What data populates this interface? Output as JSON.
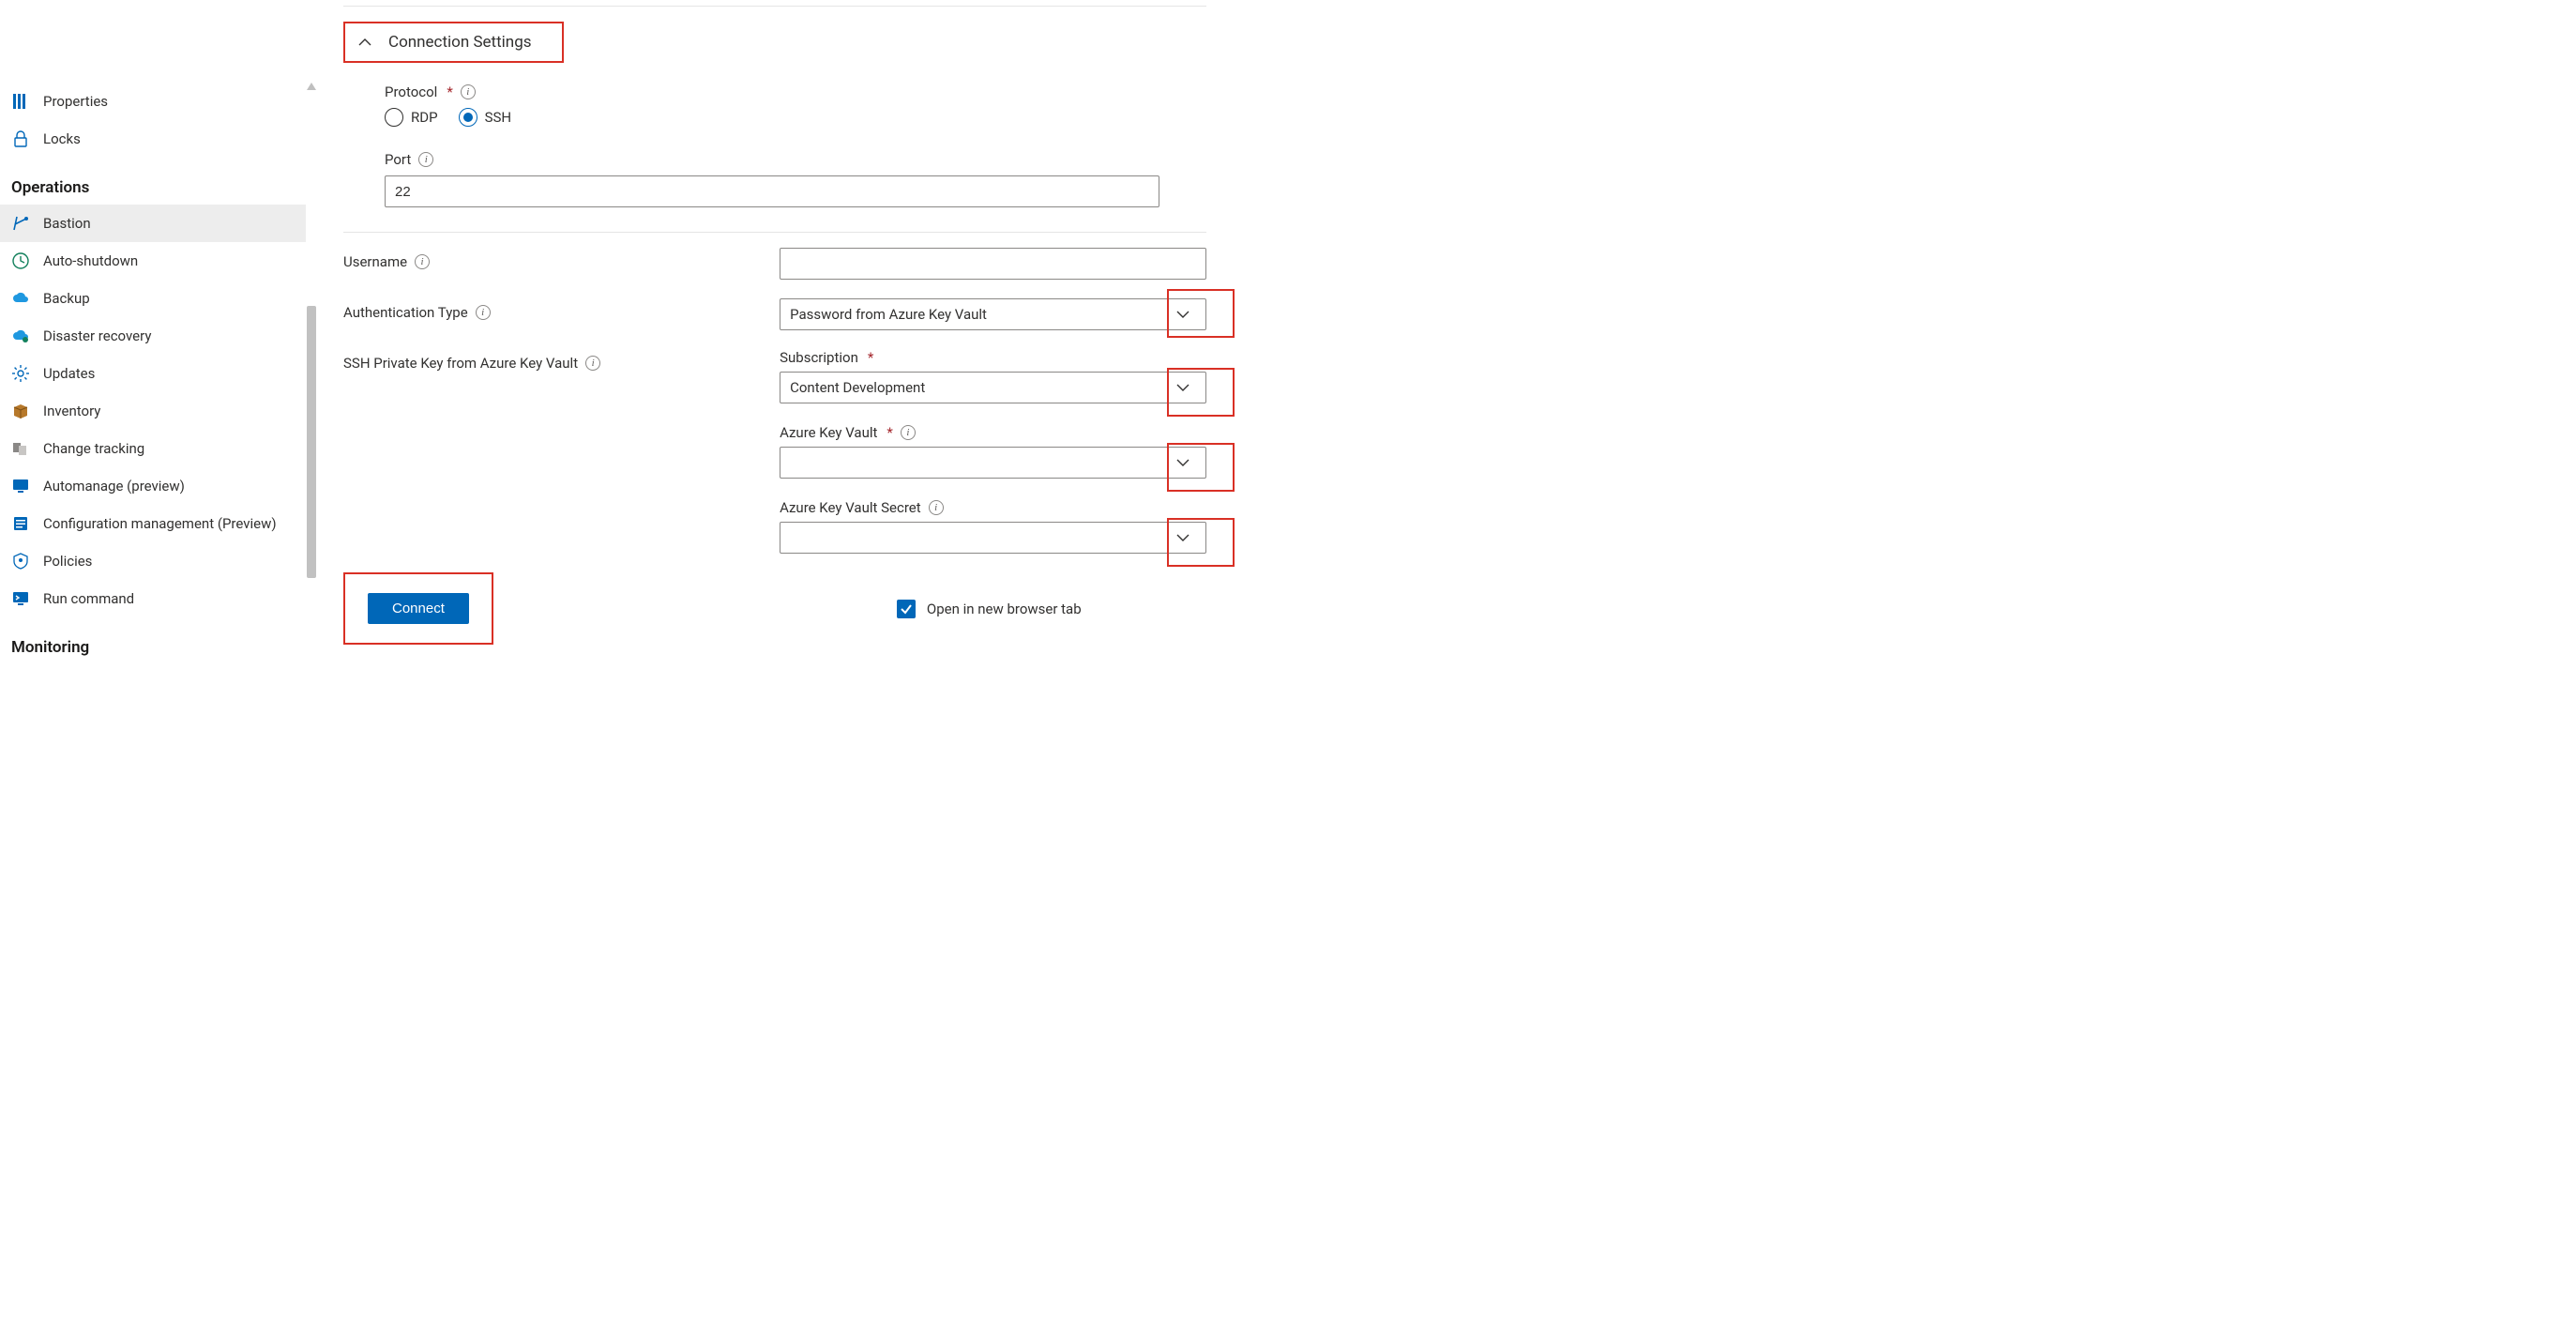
{
  "sidebar": {
    "items": [
      {
        "label": "Properties",
        "icon": "properties-icon"
      },
      {
        "label": "Locks",
        "icon": "lock-icon"
      }
    ],
    "heading1": "Operations",
    "operations": [
      {
        "label": "Bastion",
        "icon": "bastion-icon",
        "selected": true
      },
      {
        "label": "Auto-shutdown",
        "icon": "clock-icon"
      },
      {
        "label": "Backup",
        "icon": "cloud-backup-icon"
      },
      {
        "label": "Disaster recovery",
        "icon": "cloud-dr-icon"
      },
      {
        "label": "Updates",
        "icon": "gear-icon"
      },
      {
        "label": "Inventory",
        "icon": "box-icon"
      },
      {
        "label": "Change tracking",
        "icon": "change-tracking-icon"
      },
      {
        "label": "Automanage (preview)",
        "icon": "monitor-icon"
      },
      {
        "label": "Configuration management (Preview)",
        "icon": "config-icon"
      },
      {
        "label": "Policies",
        "icon": "policies-icon"
      },
      {
        "label": "Run command",
        "icon": "run-command-icon"
      }
    ],
    "heading2": "Monitoring"
  },
  "form": {
    "expander_label": "Connection Settings",
    "protocol_label": "Protocol",
    "protocol_options": {
      "rdp": "RDP",
      "ssh": "SSH"
    },
    "protocol_selected": "ssh",
    "port_label": "Port",
    "port_value": "22",
    "username_label": "Username",
    "username_value": "",
    "auth_type_label": "Authentication Type",
    "auth_type_value": "Password from Azure Key Vault",
    "ssh_kv_label": "SSH Private Key from Azure Key Vault",
    "subscription_label": "Subscription",
    "subscription_value": "Content Development",
    "kv_label": "Azure Key Vault",
    "kv_value": "",
    "kv_secret_label": "Azure Key Vault Secret",
    "kv_secret_value": "",
    "connect_label": "Connect",
    "open_tab_label": "Open in new browser tab",
    "open_tab_checked": true
  }
}
